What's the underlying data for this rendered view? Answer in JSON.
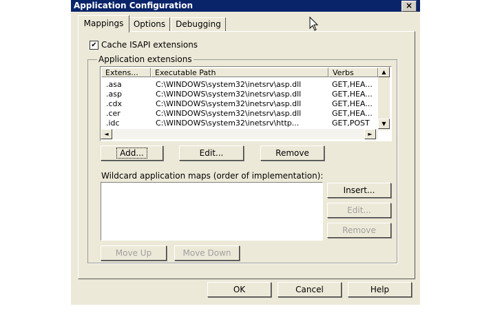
{
  "window": {
    "title": "Application Configuration",
    "close_glyph": "×"
  },
  "tabs": [
    {
      "label": "Mappings",
      "active": true
    },
    {
      "label": "Options",
      "active": false
    },
    {
      "label": "Debugging",
      "active": false
    }
  ],
  "cache": {
    "label": "Cache ISAPI extensions",
    "checked": true,
    "mark": "✔"
  },
  "extensions": {
    "group_label": "Application extensions",
    "columns": [
      "Extens...",
      "Executable Path",
      "Verbs"
    ],
    "rows": [
      {
        "ext": ".asa",
        "path": "C:\\WINDOWS\\system32\\inetsrv\\asp.dll",
        "verbs": "GET,HEA..."
      },
      {
        "ext": ".asp",
        "path": "C:\\WINDOWS\\system32\\inetsrv\\asp.dll",
        "verbs": "GET,HEA..."
      },
      {
        "ext": ".cdx",
        "path": "C:\\WINDOWS\\system32\\inetsrv\\asp.dll",
        "verbs": "GET,HEA..."
      },
      {
        "ext": ".cer",
        "path": "C:\\WINDOWS\\system32\\inetsrv\\asp.dll",
        "verbs": "GET,HEA..."
      },
      {
        "ext": ".idc",
        "path": "C:\\WINDOWS\\system32\\inetsrv\\http...",
        "verbs": "GET,POST"
      }
    ],
    "add_label": "Add...",
    "edit_label": "Edit...",
    "remove_label": "Remove"
  },
  "scroll_glyphs": {
    "up": "▲",
    "down": "▼",
    "left": "◄",
    "right": "►"
  },
  "wildcard": {
    "label": "Wildcard application maps (order of implementation):",
    "insert_label": "Insert...",
    "edit_label": "Edit...",
    "remove_label": "Remove",
    "move_up_label": "Move Up",
    "move_down_label": "Move Down"
  },
  "footer": {
    "ok_label": "OK",
    "cancel_label": "Cancel",
    "help_label": "Help"
  }
}
